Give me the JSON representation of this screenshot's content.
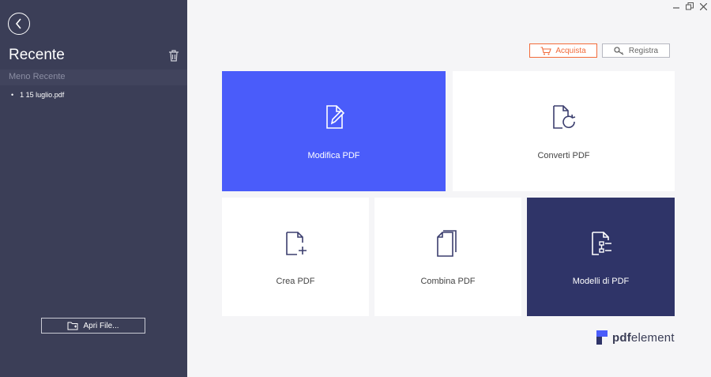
{
  "sidebar": {
    "title": "Recente",
    "section_label": "Meno Recente",
    "recent_files": [
      {
        "bullet": "•",
        "name": "1 15 luglio.pdf"
      }
    ],
    "open_file_label": "Apri File..."
  },
  "header": {
    "buy_label": "Acquista",
    "register_label": "Registra"
  },
  "tiles": [
    {
      "label": "Modifica PDF",
      "icon": "edit-pdf-icon"
    },
    {
      "label": "Converti PDF",
      "icon": "convert-pdf-icon"
    },
    {
      "label": "Crea PDF",
      "icon": "create-pdf-icon"
    },
    {
      "label": "Combina PDF",
      "icon": "combine-pdf-icon"
    },
    {
      "label": "Modelli di PDF",
      "icon": "templates-pdf-icon"
    }
  ],
  "logo": {
    "bold": "pdf",
    "rest": "element"
  },
  "colors": {
    "sidebar_bg": "#3b3e57",
    "accent_blue": "#4a5cfa",
    "accent_navy": "#2f3468",
    "buy_orange": "#f26b3a"
  }
}
